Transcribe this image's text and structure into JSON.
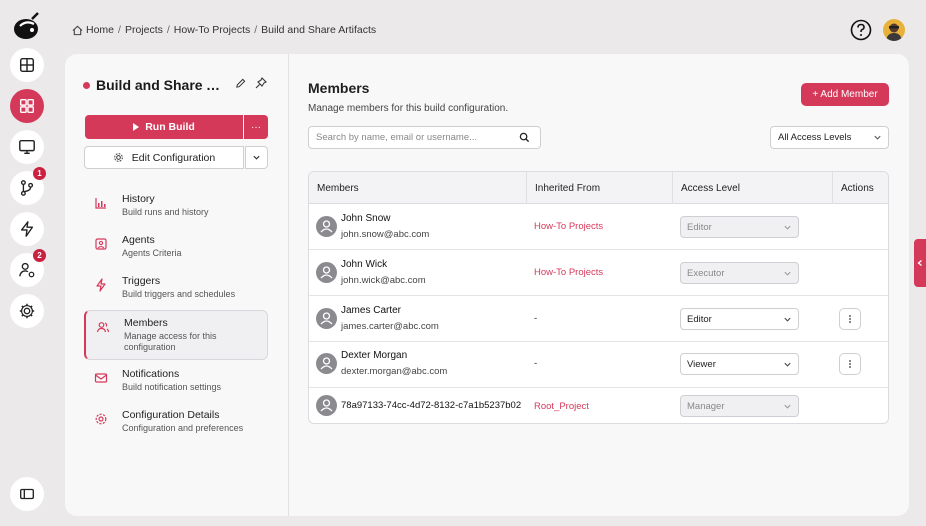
{
  "breadcrumb": [
    "Home",
    "Projects",
    "How-To Projects",
    "Build and Share Artifacts"
  ],
  "breadcrumb_sep": "/",
  "rail": {
    "items": [
      {
        "icon": "layout-icon"
      },
      {
        "icon": "dashboard-icon",
        "active": true
      },
      {
        "icon": "monitor-icon"
      },
      {
        "icon": "branch-icon",
        "badge": "1"
      },
      {
        "icon": "bolt-icon"
      },
      {
        "icon": "user-settings-icon",
        "badge": "2"
      },
      {
        "icon": "gear-icon"
      }
    ]
  },
  "config": {
    "title": "Build and Share Artifacts",
    "run_label": "Run Build",
    "run_more": "···",
    "edit_label": "Edit Configuration"
  },
  "nav": [
    {
      "title": "History",
      "sub": "Build runs and history",
      "icon": "chart-icon"
    },
    {
      "title": "Agents",
      "sub": "Agents Criteria",
      "icon": "agent-icon"
    },
    {
      "title": "Triggers",
      "sub": "Build triggers and schedules",
      "icon": "bolt-icon"
    },
    {
      "title": "Members",
      "sub": "Manage access for this configuration",
      "icon": "members-icon",
      "active": true
    },
    {
      "title": "Notifications",
      "sub": "Build notification settings",
      "icon": "mail-icon"
    },
    {
      "title": "Configuration Details",
      "sub": "Configuration and preferences",
      "icon": "gear-icon"
    }
  ],
  "members": {
    "title": "Members",
    "subtitle": "Manage members for this build configuration.",
    "add_label": "+ Add Member",
    "search_placeholder": "Search by name, email or username...",
    "access_filter": "All Access Levels",
    "columns": [
      "Members",
      "Inherited From",
      "Access Level",
      "Actions"
    ],
    "rows": [
      {
        "name": "John Snow",
        "email": "john.snow@abc.com",
        "inherited": "How-To Projects",
        "access": "Editor",
        "disabled": true,
        "actions": false
      },
      {
        "name": "John Wick",
        "email": "john.wick@abc.com",
        "inherited": "How-To Projects",
        "access": "Executor",
        "disabled": true,
        "actions": false
      },
      {
        "name": "James Carter",
        "email": "james.carter@abc.com",
        "inherited": "-",
        "access": "Editor",
        "disabled": false,
        "actions": true
      },
      {
        "name": "Dexter Morgan",
        "email": "dexter.morgan@abc.com",
        "inherited": "-",
        "access": "Viewer",
        "disabled": false,
        "actions": true
      },
      {
        "name": "78a97133-74cc-4d72-8132-c7a1b5237b02",
        "email": "",
        "inherited": "Root_Project",
        "access": "Manager",
        "disabled": true,
        "actions": false
      }
    ]
  },
  "colors": {
    "accent": "#d5395a",
    "badge": "#c9213f"
  }
}
